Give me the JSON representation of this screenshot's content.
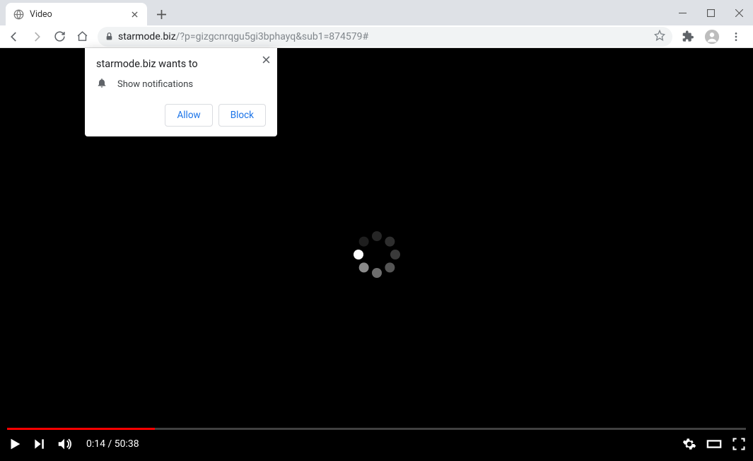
{
  "window": {
    "tab_title": "Video"
  },
  "toolbar": {
    "url_host": "starmode.biz",
    "url_path": "/?p=gizgcnrqgu5gi3bphayq&sub1=874579#"
  },
  "permission_prompt": {
    "origin_text": "starmode.biz wants to",
    "permission_label": "Show notifications",
    "allow_label": "Allow",
    "block_label": "Block"
  },
  "video": {
    "current_time": "0:14",
    "separator": " / ",
    "duration": "50:38",
    "progress_percent": 20
  }
}
